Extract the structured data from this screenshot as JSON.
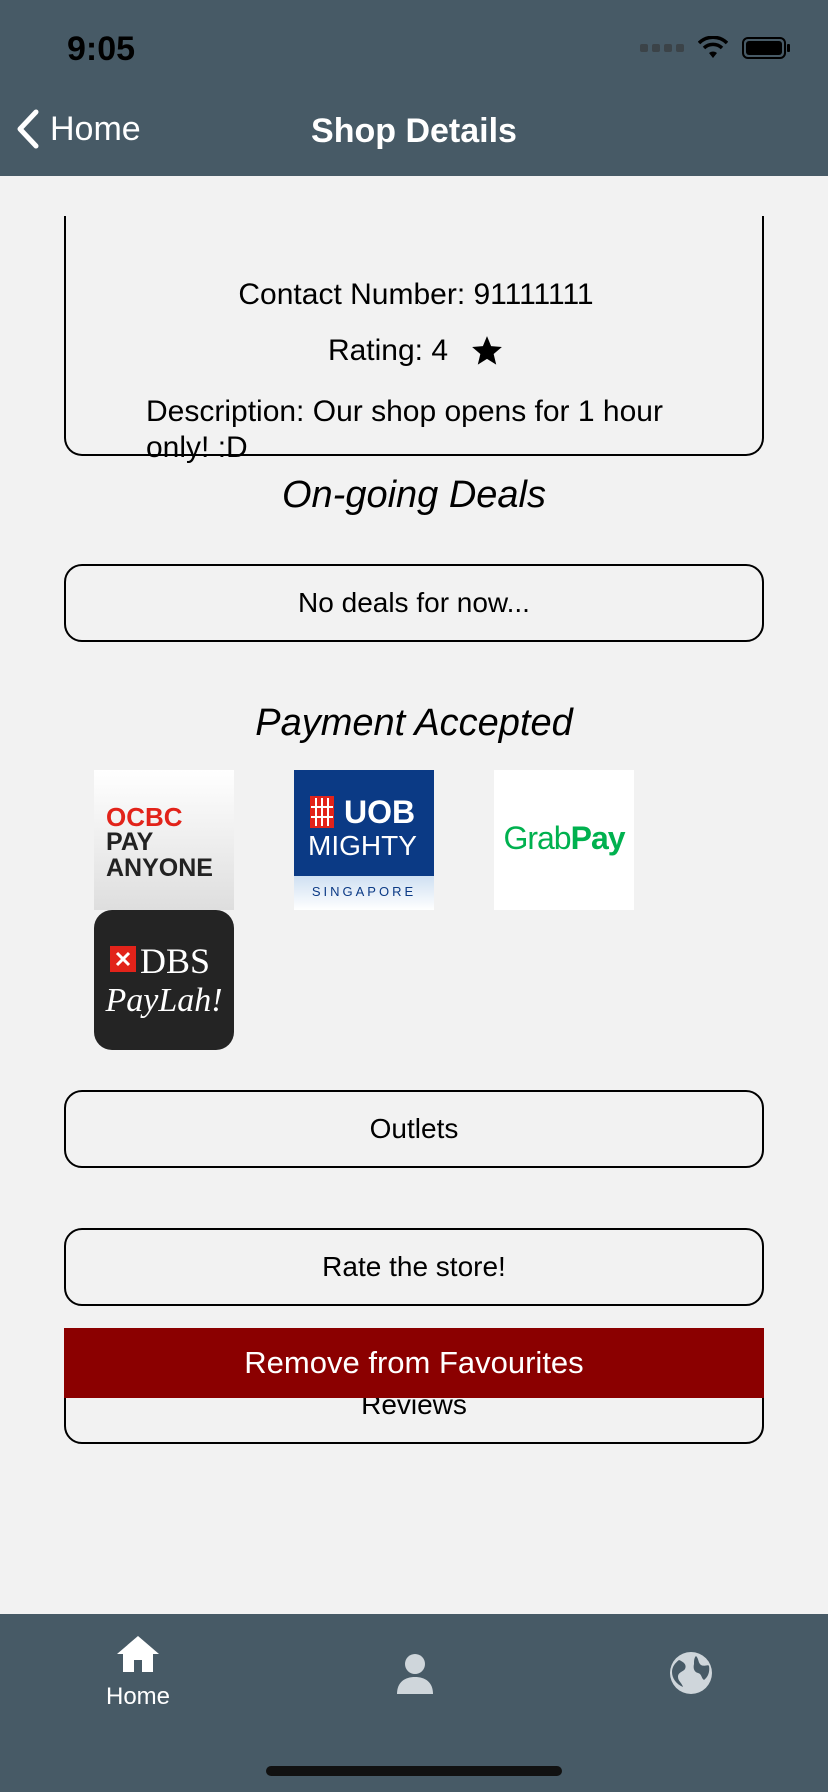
{
  "status_bar": {
    "time": "9:05"
  },
  "nav": {
    "back_label": "Home",
    "title": "Shop Details"
  },
  "shop": {
    "contact": "Contact Number: 91111111",
    "rating": "Rating: 4",
    "description": "Description: Our shop opens for 1 hour only! :D"
  },
  "deals": {
    "title": "On-going Deals",
    "empty_label": "No deals for now..."
  },
  "payment": {
    "title": "Payment Accepted",
    "methods": [
      {
        "name": "OCBC Pay Anyone",
        "line1": "OCBC",
        "line2": "PAY",
        "line3": "ANYONE"
      },
      {
        "name": "UOB Mighty",
        "line1": "UOB",
        "line2": "MIGHTY",
        "line3": "SINGAPORE"
      },
      {
        "name": "GrabPay",
        "line1": "Grab",
        "line2": "Pay"
      },
      {
        "name": "DBS PayLah!",
        "line1": "DBS",
        "line2": "PayLah!"
      }
    ]
  },
  "actions": {
    "outlets": "Outlets",
    "rate": "Rate the store!",
    "reviews": "Reviews",
    "remove_favourite": "Remove from Favourites"
  },
  "tabs": [
    {
      "label": "Home",
      "icon": "home-icon",
      "active": true
    },
    {
      "label": "",
      "icon": "person-icon",
      "active": false
    },
    {
      "label": "",
      "icon": "globe-icon",
      "active": false
    }
  ],
  "colors": {
    "header": "#475a66",
    "remove_button": "#8b0000",
    "background": "#f2f2f2"
  }
}
